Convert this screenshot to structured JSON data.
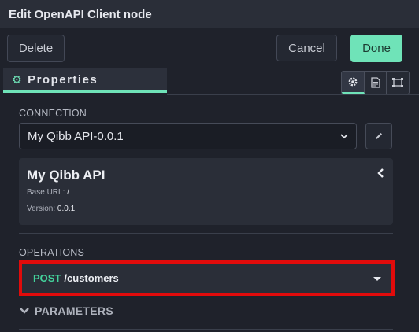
{
  "header": {
    "title": "Edit OpenAPI Client node"
  },
  "toolbar": {
    "delete_label": "Delete",
    "cancel_label": "Cancel",
    "done_label": "Done"
  },
  "tabs": {
    "properties_label": "Properties",
    "icons": [
      "gear-icon",
      "document-icon",
      "frame-icon"
    ]
  },
  "connection": {
    "label": "CONNECTION",
    "selected": "My Qibb API-0.0.1",
    "api": {
      "title": "My Qibb API",
      "base_url_label": "Base URL:",
      "base_url": "/",
      "version_label": "Version:",
      "version": "0.0.1"
    }
  },
  "operations": {
    "label": "OPERATIONS",
    "method": "POST",
    "path": "/customers"
  },
  "parameters": {
    "label": "PARAMETERS"
  },
  "colors": {
    "accent": "#6fe3b8",
    "method_post": "#43d39c",
    "highlight": "#e10b0b",
    "background": "#1f222b"
  }
}
